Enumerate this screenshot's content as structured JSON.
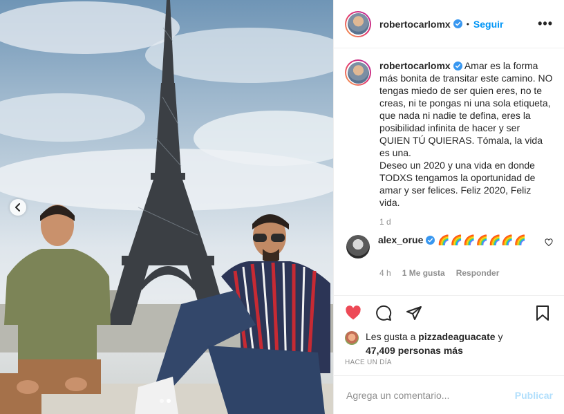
{
  "post": {
    "author": {
      "username": "robertocarlomx",
      "verified": true,
      "follow_label": "Seguir",
      "more_icon": "more-horizontal-icon"
    },
    "caption": {
      "username": "robertocarlomx",
      "text": "Amar es la forma más bonita de transitar este camino. NO tengas miedo de ser quien eres, no te creas, ni te pongas ni una sola etiqueta, que nada ni nadie te defina, eres la posibilidad infinita de hacer y ser QUIEN TÚ QUIERAS. Tómala, la vida es una.\nDeseo un 2020 y una vida en donde TODXS tengamos la oportunidad de amar y ser felices. Feliz 2020, Feliz vida.",
      "time": "1 d"
    },
    "comments": [
      {
        "username": "alex_orue",
        "verified": true,
        "text": "🌈🌈🌈🌈🌈🌈🌈",
        "time": "4 h",
        "likes_label": "1 Me gusta",
        "reply_label": "Responder"
      }
    ],
    "likes": {
      "prefix": "Les gusta a",
      "liker": "pizzadeaguacate",
      "conjunction": "y",
      "count_text": "47,409 personas más"
    },
    "date_label": "HACE UN DÍA",
    "add_comment": {
      "placeholder": "Agrega un comentario...",
      "publish_label": "Publicar"
    },
    "carousel": {
      "current_index": 2,
      "total": 2
    },
    "colors": {
      "accent": "#0095f6",
      "like_red": "#ed4956",
      "muted": "#8e8e8e",
      "publish_disabled": "#b2dffc"
    }
  }
}
